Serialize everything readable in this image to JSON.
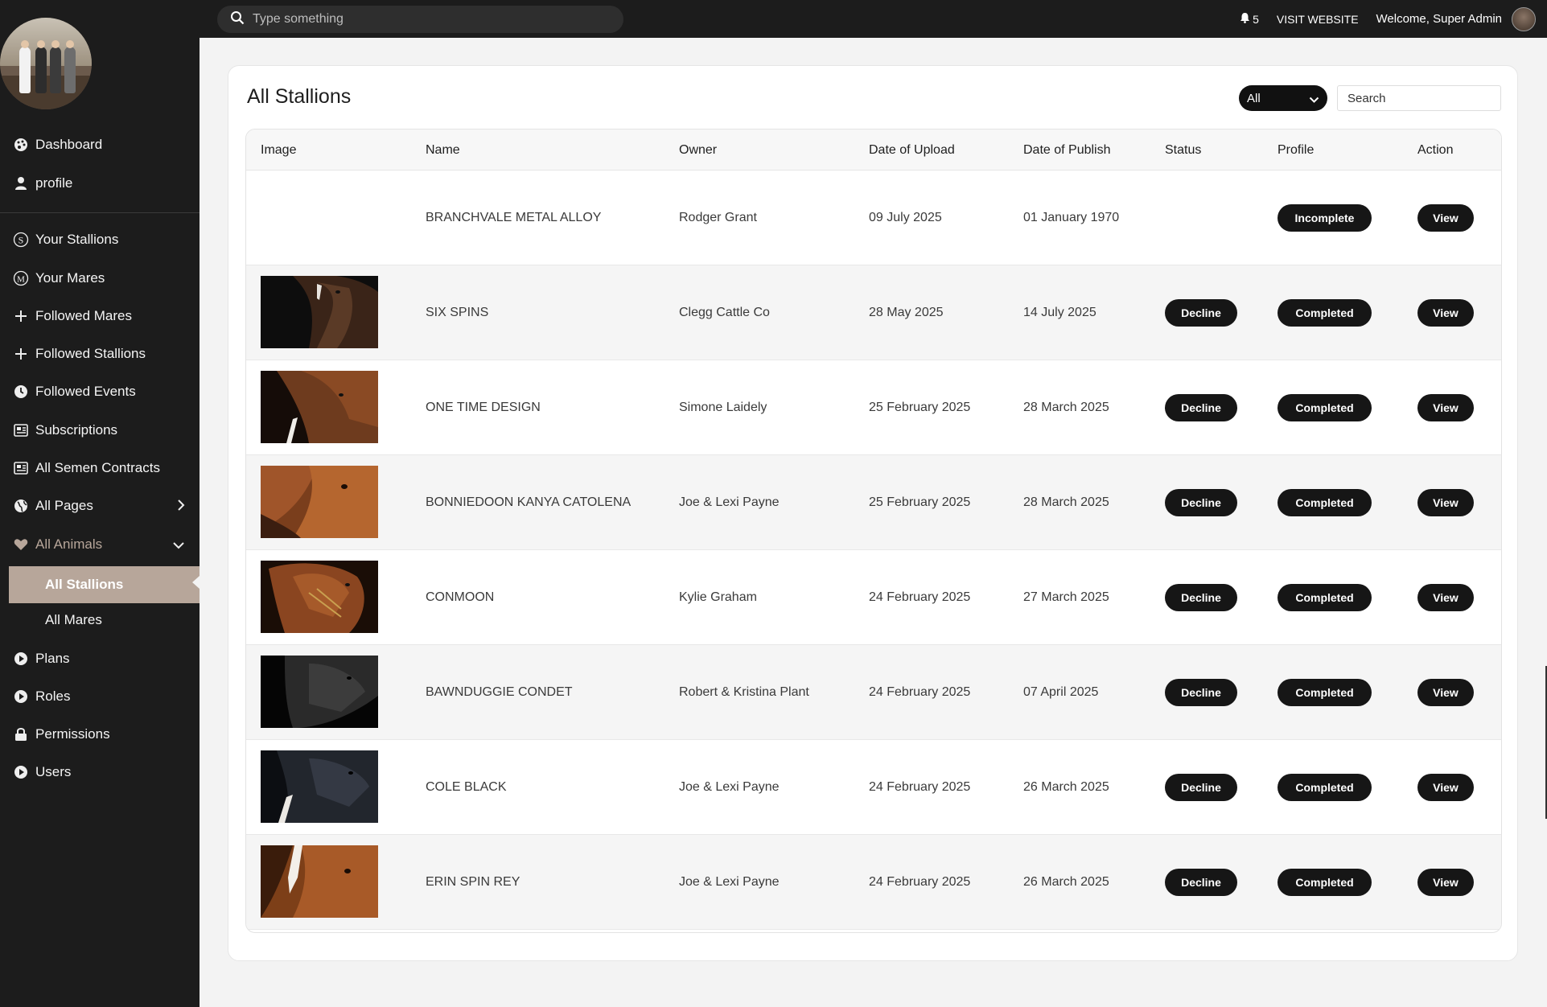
{
  "topbar": {
    "search_placeholder": "Type something",
    "notification_count": "5",
    "visit_website": "VISIT WEBSITE",
    "welcome": "Welcome, Super Admin"
  },
  "sidebar": {
    "items": [
      {
        "label": "Dashboard",
        "icon": "palette-icon"
      },
      {
        "label": "profile",
        "icon": "user-icon"
      },
      {
        "label": "Your Stallions",
        "icon": "stallion-s-icon"
      },
      {
        "label": "Your Mares",
        "icon": "mare-m-icon"
      },
      {
        "label": "Followed Mares",
        "icon": "plus-icon"
      },
      {
        "label": "Followed Stallions",
        "icon": "plus-icon"
      },
      {
        "label": "Followed Events",
        "icon": "clock-icon"
      },
      {
        "label": "Subscriptions",
        "icon": "newspaper-icon"
      },
      {
        "label": "All Semen Contracts",
        "icon": "newspaper-icon"
      },
      {
        "label": "All Pages",
        "icon": "globe-icon"
      },
      {
        "label": "All Animals",
        "icon": "heart-icon"
      },
      {
        "label": "All Stallions",
        "icon": ""
      },
      {
        "label": "All Mares",
        "icon": ""
      },
      {
        "label": "Plans",
        "icon": "play-circle-icon"
      },
      {
        "label": "Roles",
        "icon": "play-circle-icon"
      },
      {
        "label": "Permissions",
        "icon": "lock-icon"
      },
      {
        "label": "Users",
        "icon": "play-circle-icon"
      }
    ]
  },
  "page": {
    "title": "All Stallions",
    "filter_value": "All",
    "search_placeholder": "Search"
  },
  "table": {
    "headers": [
      "Image",
      "Name",
      "Owner",
      "Date of Upload",
      "Date of Publish",
      "Status",
      "Profile",
      "Action"
    ],
    "rows": [
      {
        "name": "BRANCHVALE METAL ALLOY",
        "owner": "Rodger Grant",
        "uploaded": "09 July 2025",
        "published": "01 January 1970",
        "status": "",
        "profile": "Incomplete",
        "action": "View",
        "image": "none"
      },
      {
        "name": "SIX SPINS",
        "owner": "Clegg Cattle Co",
        "uploaded": "28 May 2025",
        "published": "14 July 2025",
        "status": "Decline",
        "profile": "Completed",
        "action": "View",
        "image": "dark-bay-horse"
      },
      {
        "name": "ONE TIME DESIGN",
        "owner": "Simone Laidely",
        "uploaded": "25 February 2025",
        "published": "28 March 2025",
        "status": "Decline",
        "profile": "Completed",
        "action": "View",
        "image": "bay-horse-blaze"
      },
      {
        "name": "BONNIEDOON KANYA CATOLENA",
        "owner": "Joe & Lexi Payne",
        "uploaded": "25 February 2025",
        "published": "28 March 2025",
        "status": "Decline",
        "profile": "Completed",
        "action": "View",
        "image": "chestnut-horse"
      },
      {
        "name": "CONMOON",
        "owner": "Kylie Graham",
        "uploaded": "24 February 2025",
        "published": "27 March 2025",
        "status": "Decline",
        "profile": "Completed",
        "action": "View",
        "image": "chestnut-horse-halter"
      },
      {
        "name": "BAWNDUGGIE CONDET",
        "owner": "Robert & Kristina Plant",
        "uploaded": "24 February 2025",
        "published": "07 April 2025",
        "status": "Decline",
        "profile": "Completed",
        "action": "View",
        "image": "black-horse"
      },
      {
        "name": "COLE BLACK",
        "owner": "Joe & Lexi Payne",
        "uploaded": "24 February 2025",
        "published": "26 March 2025",
        "status": "Decline",
        "profile": "Completed",
        "action": "View",
        "image": "black-horse-blaze"
      },
      {
        "name": "ERIN SPIN REY",
        "owner": "Joe & Lexi Payne",
        "uploaded": "24 February 2025",
        "published": "26 March 2025",
        "status": "Decline",
        "profile": "Completed",
        "action": "View",
        "image": "sorrel-horse-blaze"
      }
    ]
  },
  "colors": {
    "sidebar_bg": "#1c1c1c",
    "accent": "#b7a69a",
    "pill_bg": "#161616"
  }
}
